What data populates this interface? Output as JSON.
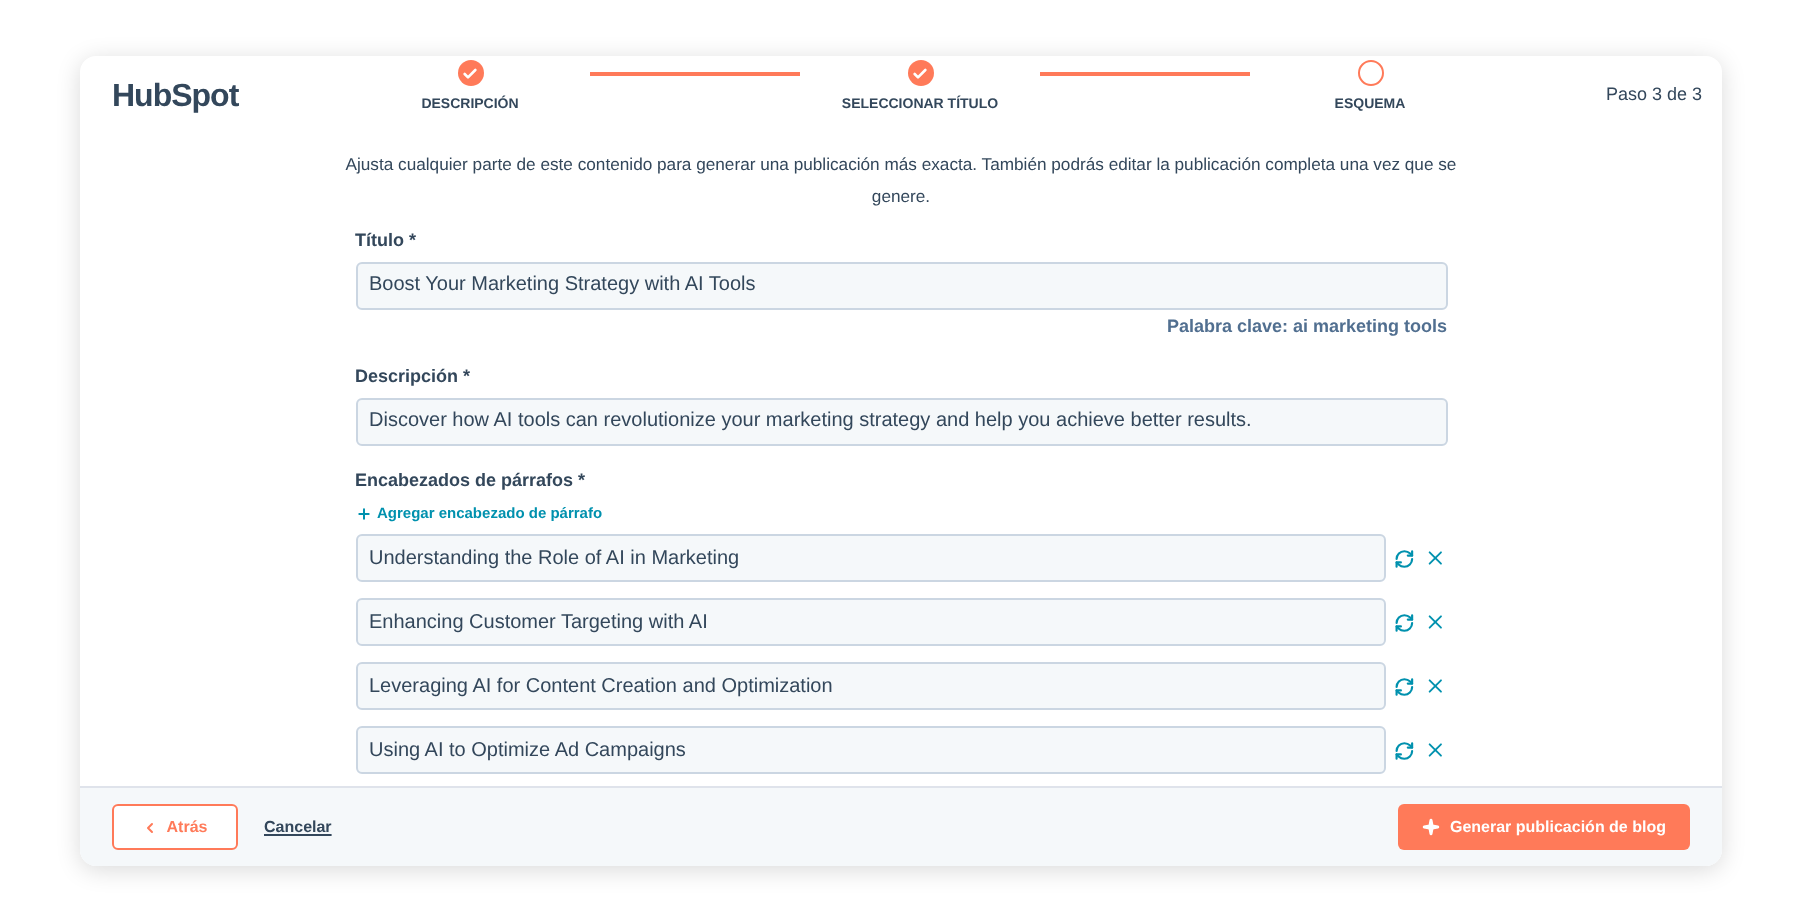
{
  "header": {
    "logo": "HubSpot",
    "steps": [
      {
        "label": "DESCRIPCIÓN",
        "completed": true
      },
      {
        "label": "SELECCIONAR TÍTULO",
        "completed": true
      },
      {
        "label": "ESQUEMA",
        "completed": false
      }
    ],
    "step_count": "Paso 3 de 3"
  },
  "intro": "Ajusta cualquier parte de este contenido para generar una publicación más exacta. También podrás editar la publicación completa una vez que se genere.",
  "title_field": {
    "label": "Título *",
    "value": "Boost Your Marketing Strategy with AI Tools",
    "keyword": "Palabra clave: ai marketing tools"
  },
  "description_field": {
    "label": "Descripción *",
    "value": "Discover how AI tools can revolutionize your marketing strategy and help you achieve better results."
  },
  "headings": {
    "label": "Encabezados de párrafos *",
    "add_link": "Agregar encabezado de párrafo",
    "items": [
      "Understanding the Role of AI in Marketing",
      "Enhancing Customer Targeting with AI",
      "Leveraging AI for Content Creation and Optimization",
      "Using AI to Optimize Ad Campaigns"
    ]
  },
  "footer": {
    "back": "Atrás",
    "cancel": "Cancelar",
    "generate": "Generar publicación de blog"
  }
}
